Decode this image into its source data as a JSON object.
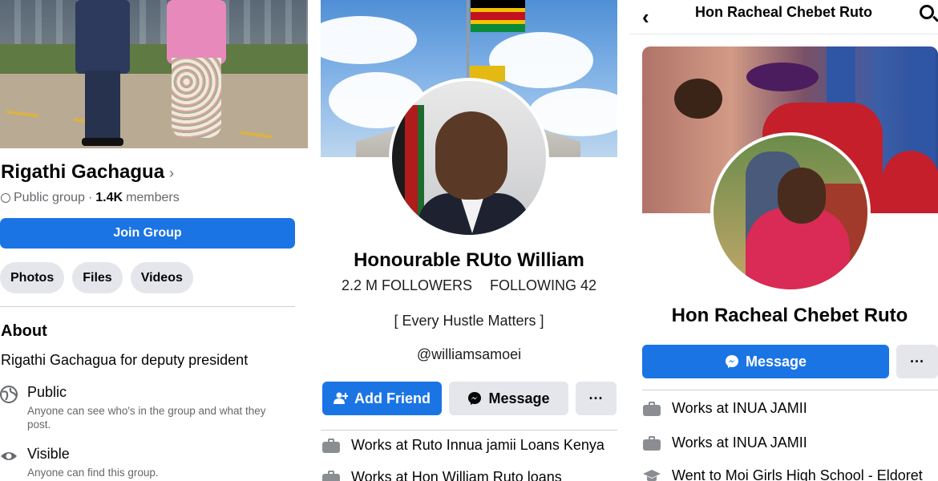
{
  "panel1": {
    "group_name": "Rigathi Gachagua",
    "chevron": "›",
    "privacy": "Public group",
    "separator": "·",
    "member_count": "1.4K",
    "members_label": "members",
    "join_button": "Join Group",
    "tabs": [
      "Photos",
      "Files",
      "Videos"
    ],
    "about_heading": "About",
    "about_description": "Rigathi Gachagua for deputy president",
    "info": [
      {
        "icon": "globe-icon",
        "title": "Public",
        "detail": "Anyone can see who's in the group and what they post."
      },
      {
        "icon": "eye-icon",
        "title": "Visible",
        "detail": "Anyone can find this group."
      }
    ]
  },
  "panel2": {
    "name": "Honourable RUto William",
    "followers": "2.2 M FOLLOWERS",
    "following": "FOLLOWING 42",
    "bio": "[ Every Hustle Matters ]",
    "handle": "@williamsamoei",
    "add_friend_button": "Add Friend",
    "message_button": "Message",
    "more_button": "···",
    "work": [
      {
        "prefix": "Works at",
        "place": "Ruto Innua jamii Loans Kenya"
      },
      {
        "prefix": "Works at",
        "place": "Hon William Ruto loans"
      }
    ]
  },
  "panel3": {
    "top_title": "Hon Racheal Chebet Ruto",
    "name": "Hon Racheal Chebet Ruto",
    "message_button": "Message",
    "more_button": "···",
    "details": [
      {
        "icon": "briefcase-icon",
        "prefix": "Works at",
        "place": "INUA JAMII"
      },
      {
        "icon": "briefcase-icon",
        "prefix": "Works at",
        "place": "INUA JAMII"
      },
      {
        "icon": "graduation-cap-icon",
        "prefix": "Went to",
        "place": "Moi Girls High School - Eldoret"
      }
    ]
  },
  "colors": {
    "primary_blue": "#1b74e4",
    "button_grey": "#e4e6eb",
    "secondary_text": "#65676b"
  }
}
